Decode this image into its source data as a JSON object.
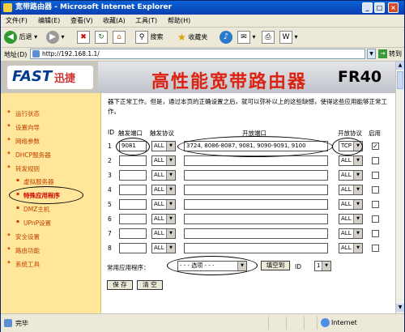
{
  "window": {
    "title": "宽带路由器 - Microsoft Internet Explorer"
  },
  "menu": [
    "文件(F)",
    "编辑(E)",
    "查看(V)",
    "收藏(A)",
    "工具(T)",
    "帮助(H)"
  ],
  "toolbar": {
    "back": "后退",
    "search": "搜索",
    "favorites": "收藏夹"
  },
  "address": {
    "label": "地址(D)",
    "url": "http://192.168.1.1/",
    "go": "转到"
  },
  "banner": {
    "logo": "FAST",
    "logo_cn": "迅捷",
    "title": "高性能宽带路由器",
    "model": "FR40"
  },
  "sidebar": {
    "items": [
      "运行状态",
      "设置向导",
      "网络参数",
      "DHCP服务器",
      "转发规则",
      "虚拟服务器",
      "特殊应用程序",
      "DMZ主机",
      "UPnP设置",
      "安全设置",
      "路由功能",
      "系统工具"
    ]
  },
  "description": "器下正常工作。但是，通过本页的正确设置之后，就可以弥补以上的这些缺憾，使得这些应用能够正常工作。",
  "table": {
    "headers": {
      "id": "ID",
      "trigger_port": "触发端口",
      "trigger_proto": "触发协议",
      "open_port": "开放端口",
      "open_proto": "开放协议",
      "enable": "启用"
    },
    "rows": [
      {
        "id": "1",
        "trigger_port": "9081",
        "trigger_proto": "ALL",
        "open_port": "3724, 8086-8087, 9081, 9090-9091, 9100",
        "open_proto": "TCP",
        "enabled": "✓"
      },
      {
        "id": "2",
        "trigger_port": "",
        "trigger_proto": "ALL",
        "open_port": "",
        "open_proto": "ALL",
        "enabled": ""
      },
      {
        "id": "3",
        "trigger_port": "",
        "trigger_proto": "ALL",
        "open_port": "",
        "open_proto": "ALL",
        "enabled": ""
      },
      {
        "id": "4",
        "trigger_port": "",
        "trigger_proto": "ALL",
        "open_port": "",
        "open_proto": "ALL",
        "enabled": ""
      },
      {
        "id": "5",
        "trigger_port": "",
        "trigger_proto": "ALL",
        "open_port": "",
        "open_proto": "ALL",
        "enabled": ""
      },
      {
        "id": "6",
        "trigger_port": "",
        "trigger_proto": "ALL",
        "open_port": "",
        "open_proto": "ALL",
        "enabled": ""
      },
      {
        "id": "7",
        "trigger_port": "",
        "trigger_proto": "ALL",
        "open_port": "",
        "open_proto": "ALL",
        "enabled": ""
      },
      {
        "id": "8",
        "trigger_port": "",
        "trigger_proto": "ALL",
        "open_port": "",
        "open_proto": "ALL",
        "enabled": ""
      }
    ]
  },
  "common_apps": {
    "label": "常用应用程序：",
    "select": "- - - 选项 - - -",
    "fill_button": "填空到",
    "id_label": "ID",
    "id_value": "1"
  },
  "actions": {
    "save": "保 存",
    "clear": "清 空"
  },
  "status": {
    "text": "完毕",
    "zone": "Internet"
  }
}
